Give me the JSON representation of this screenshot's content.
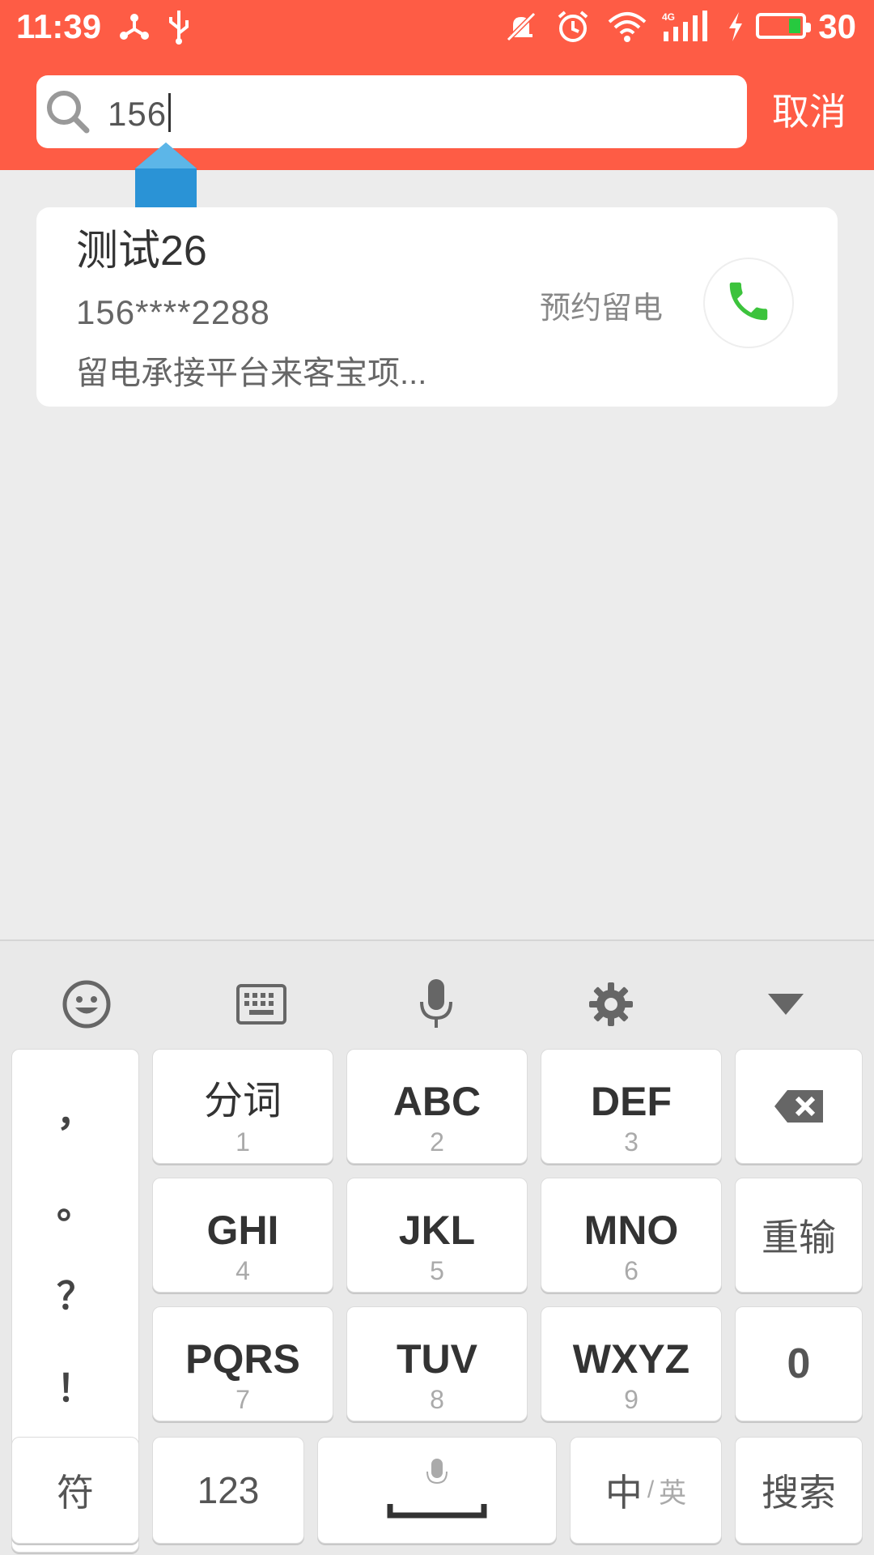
{
  "status_bar": {
    "time": "11:39",
    "battery_level": "30",
    "battery_fraction": 0.3,
    "icons": [
      "usb-tether-icon",
      "usb-icon",
      "silent-icon",
      "alarm-icon",
      "wifi-icon",
      "signal-4g-icon",
      "charging-icon",
      "battery-icon"
    ]
  },
  "search": {
    "value": "156",
    "cancel_label": "取消"
  },
  "result": {
    "name": "测试26",
    "phone": "156****2288",
    "description": "留电承接平台来客宝项...",
    "action_label": "预约留电"
  },
  "keyboard": {
    "punctuation": [
      "，",
      "。",
      "？",
      "！"
    ],
    "row1": [
      {
        "main": "分词",
        "sub": "1"
      },
      {
        "main": "ABC",
        "sub": "2"
      },
      {
        "main": "DEF",
        "sub": "3"
      }
    ],
    "row2": [
      {
        "main": "GHI",
        "sub": "4"
      },
      {
        "main": "JKL",
        "sub": "5"
      },
      {
        "main": "MNO",
        "sub": "6"
      }
    ],
    "row3": [
      {
        "main": "PQRS",
        "sub": "7"
      },
      {
        "main": "TUV",
        "sub": "8"
      },
      {
        "main": "WXYZ",
        "sub": "9"
      }
    ],
    "reenter": "重输",
    "zero": "0",
    "symbols": "符",
    "numbers": "123",
    "lang_cn": "中",
    "lang_sep": "/",
    "lang_en": "英",
    "search_key": "搜索"
  },
  "colors": {
    "header": "#fe5c45",
    "call_green": "#3cc33c",
    "handle_blue": "#2a93d6"
  }
}
